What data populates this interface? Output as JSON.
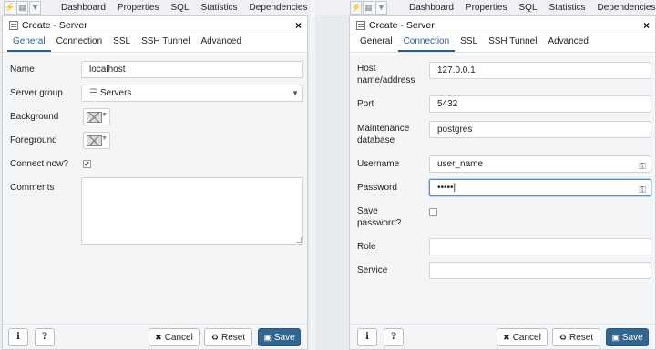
{
  "toolbar": {
    "icons": [
      "lightning-icon",
      "grid-icon",
      "filter-icon"
    ],
    "tabs": [
      "Dashboard",
      "Properties",
      "SQL",
      "Statistics",
      "Dependencies"
    ]
  },
  "colors": {
    "accent": "#2c5d8f",
    "save_button": "#326690"
  },
  "left_dialog": {
    "title": "Create - Server",
    "close": "×",
    "tabs": [
      "General",
      "Connection",
      "SSL",
      "SSH Tunnel",
      "Advanced"
    ],
    "active_tab": "General",
    "fields": {
      "name_label": "Name",
      "name_value": "localhost",
      "server_group_label": "Server group",
      "server_group_value": "Servers",
      "background_label": "Background",
      "foreground_label": "Foreground",
      "connect_now_label": "Connect now?",
      "connect_now_mark": "✔",
      "comments_label": "Comments"
    },
    "footer": {
      "info": "i",
      "help": "?",
      "cancel": "Cancel",
      "reset": "Reset",
      "save": "Save"
    }
  },
  "right_dialog": {
    "title": "Create - Server",
    "close": "×",
    "tabs": [
      "General",
      "Connection",
      "SSL",
      "SSH Tunnel",
      "Advanced"
    ],
    "active_tab": "Connection",
    "fields": {
      "host_label_1": "Host",
      "host_label_2": "name/address",
      "host_value": "127.0.0.1",
      "port_label": "Port",
      "port_value": "5432",
      "maint_label_1": "Maintenance",
      "maint_label_2": "database",
      "maint_value": "postgres",
      "username_label": "Username",
      "username_value": "user_name",
      "password_label": "Password",
      "password_value": "•••••",
      "save_password_label_1": "Save",
      "save_password_label_2": "password?",
      "role_label": "Role",
      "role_value": "",
      "service_label": "Service",
      "service_value": ""
    },
    "footer": {
      "info": "i",
      "help": "?",
      "cancel": "Cancel",
      "reset": "Reset",
      "save": "Save"
    }
  }
}
